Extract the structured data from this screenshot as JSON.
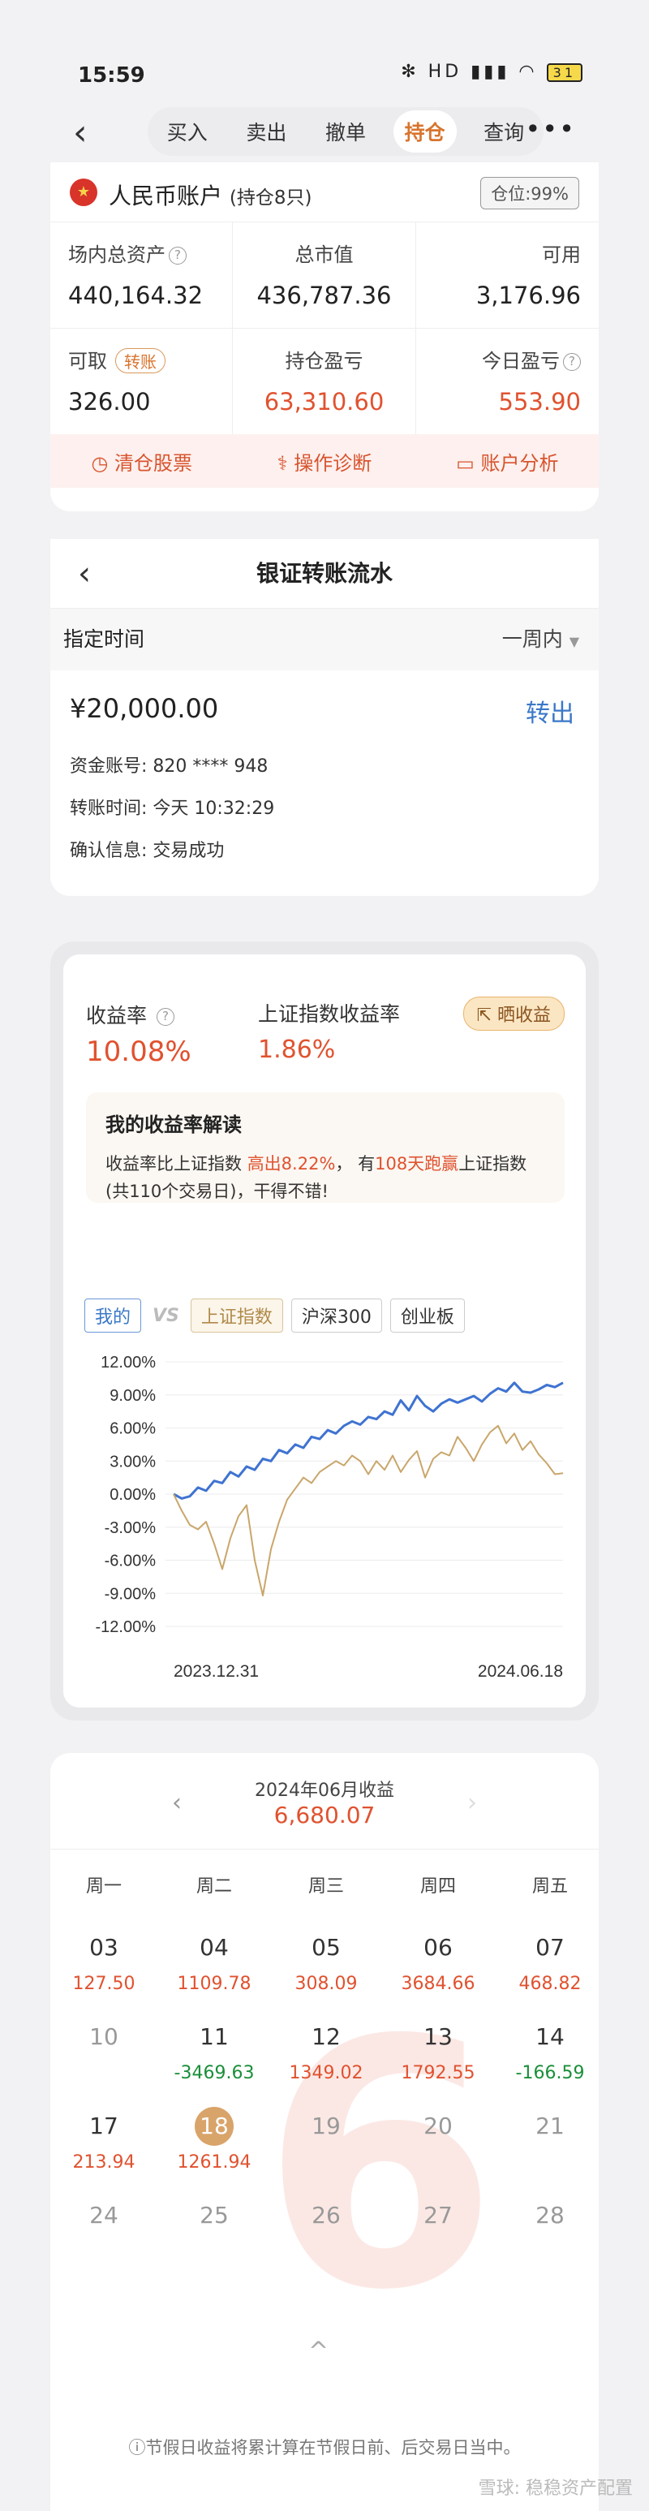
{
  "status": {
    "time": "15:59",
    "icons_text": "✻ HD ▮▮▮ ◠",
    "battery": "31"
  },
  "nav": {
    "back": "‹",
    "tabs": [
      "买入",
      "卖出",
      "撤单",
      "持仓",
      "查询"
    ],
    "active_tab": "持仓",
    "more": "•••"
  },
  "account": {
    "title": "人民币账户",
    "subtitle": "(持仓8只)",
    "position_ratio": "仓位:99%",
    "total_assets_label": "场内总资产",
    "total_assets": "440,164.32",
    "market_value_label": "总市值",
    "market_value": "436,787.36",
    "available_label": "可用",
    "available": "3,176.96",
    "withdrawable_label": "可取",
    "transfer_tag": "转账",
    "withdrawable": "326.00",
    "holding_pl_label": "持仓盈亏",
    "holding_pl": "63,310.60",
    "today_pl_label": "今日盈亏",
    "today_pl": "553.90",
    "actions": [
      {
        "icon": "clock-icon",
        "label": "清仓股票"
      },
      {
        "icon": "stethoscope-icon",
        "label": "操作诊断"
      },
      {
        "icon": "chart-icon",
        "label": "账户分析"
      }
    ]
  },
  "transfer": {
    "title": "银证转账流水",
    "time_label": "指定时间",
    "time_range": "一周内",
    "amount": "¥20,000.00",
    "direction": "转出",
    "account_line": "资金账号:  820 **** 948",
    "time_line": "转账时间:  今天 10:32:29",
    "confirm_line": "确认信息:  交易成功"
  },
  "returns": {
    "my_label": "收益率",
    "my_value": "10.08%",
    "index_label": "上证指数收益率",
    "index_value": "1.86%",
    "share_label": "晒收益",
    "interp_title": "我的收益率解读",
    "interp_line1_a": "收益率比上证指数 ",
    "interp_line1_b": "高出8.22%",
    "interp_line1_c": "，  有",
    "interp_line1_d": "108天跑赢",
    "interp_line1_e": "上证指数",
    "interp_line2": "(共110个交易日)，干得不错!",
    "tabs": [
      "我的",
      "VS",
      "上证指数",
      "沪深300",
      "创业板"
    ]
  },
  "chart_data": {
    "type": "line",
    "x_start": "2023.12.31",
    "x_end": "2024.06.18",
    "y_ticks": [
      "12.00%",
      "9.00%",
      "6.00%",
      "3.00%",
      "0.00%",
      "-3.00%",
      "-6.00%",
      "-9.00%",
      "-12.00%"
    ],
    "ylim": [
      -12,
      12
    ],
    "grid": true,
    "series": [
      {
        "name": "我的",
        "color": "#3f73d1",
        "values": [
          0,
          -0.4,
          -0.2,
          0.6,
          0.3,
          1.2,
          1.0,
          2.0,
          1.6,
          2.5,
          2.2,
          3.2,
          3.0,
          4.0,
          3.7,
          4.5,
          4.2,
          5.2,
          5.0,
          5.8,
          5.5,
          6.2,
          6.6,
          6.3,
          7.0,
          6.8,
          7.5,
          7.2,
          8.5,
          7.6,
          8.9,
          8.0,
          7.5,
          8.2,
          8.6,
          8.3,
          8.6,
          8.9,
          8.4,
          9.1,
          9.6,
          9.3,
          10.1,
          9.3,
          9.2,
          9.5,
          9.9,
          9.7,
          10.1
        ]
      },
      {
        "name": "上证指数",
        "color": "#c9a66b",
        "values": [
          0,
          -1.5,
          -2.8,
          -3.2,
          -2.5,
          -4.5,
          -6.8,
          -4.0,
          -2.0,
          -1.0,
          -6.0,
          -9.2,
          -5.0,
          -2.5,
          -0.5,
          0.5,
          1.5,
          1.0,
          2.0,
          2.5,
          3.0,
          2.6,
          3.5,
          3.0,
          1.8,
          3.0,
          2.2,
          3.5,
          2.0,
          3.1,
          3.9,
          1.5,
          3.2,
          3.8,
          3.5,
          5.2,
          4.2,
          3.0,
          4.5,
          5.6,
          6.2,
          4.6,
          5.5,
          4.0,
          4.8,
          3.6,
          2.8,
          1.8,
          1.9
        ]
      }
    ]
  },
  "calendar": {
    "month": "2024年06月收益",
    "total": "6,680.07",
    "prev": "‹",
    "next": "›",
    "weekdays": [
      "周一",
      "周二",
      "周三",
      "周四",
      "周五"
    ],
    "rows": [
      [
        {
          "d": "03",
          "a": "127.50",
          "s": "up"
        },
        {
          "d": "04",
          "a": "1109.78",
          "s": "up"
        },
        {
          "d": "05",
          "a": "308.09",
          "s": "up"
        },
        {
          "d": "06",
          "a": "3684.66",
          "s": "up"
        },
        {
          "d": "07",
          "a": "468.82",
          "s": "up"
        }
      ],
      [
        {
          "d": "10",
          "a": "",
          "s": "none"
        },
        {
          "d": "11",
          "a": "-3469.63",
          "s": "down"
        },
        {
          "d": "12",
          "a": "1349.02",
          "s": "up"
        },
        {
          "d": "13",
          "a": "1792.55",
          "s": "up"
        },
        {
          "d": "14",
          "a": "-166.59",
          "s": "down"
        }
      ],
      [
        {
          "d": "17",
          "a": "213.94",
          "s": "up"
        },
        {
          "d": "18",
          "a": "1261.94",
          "s": "up",
          "today": true
        },
        {
          "d": "19",
          "a": "",
          "s": "future"
        },
        {
          "d": "20",
          "a": "",
          "s": "future"
        },
        {
          "d": "21",
          "a": "",
          "s": "future"
        }
      ],
      [
        {
          "d": "24",
          "a": "",
          "s": "future"
        },
        {
          "d": "25",
          "a": "",
          "s": "future"
        },
        {
          "d": "26",
          "a": "",
          "s": "future"
        },
        {
          "d": "27",
          "a": "",
          "s": "future"
        },
        {
          "d": "28",
          "a": "",
          "s": "future"
        }
      ]
    ],
    "watermark_digit": "6",
    "footnote": "ⓘ节假日收益将累计算在节假日前、后交易日当中。",
    "caret": "^"
  },
  "watermark": "雪球: 稳稳资产配置"
}
